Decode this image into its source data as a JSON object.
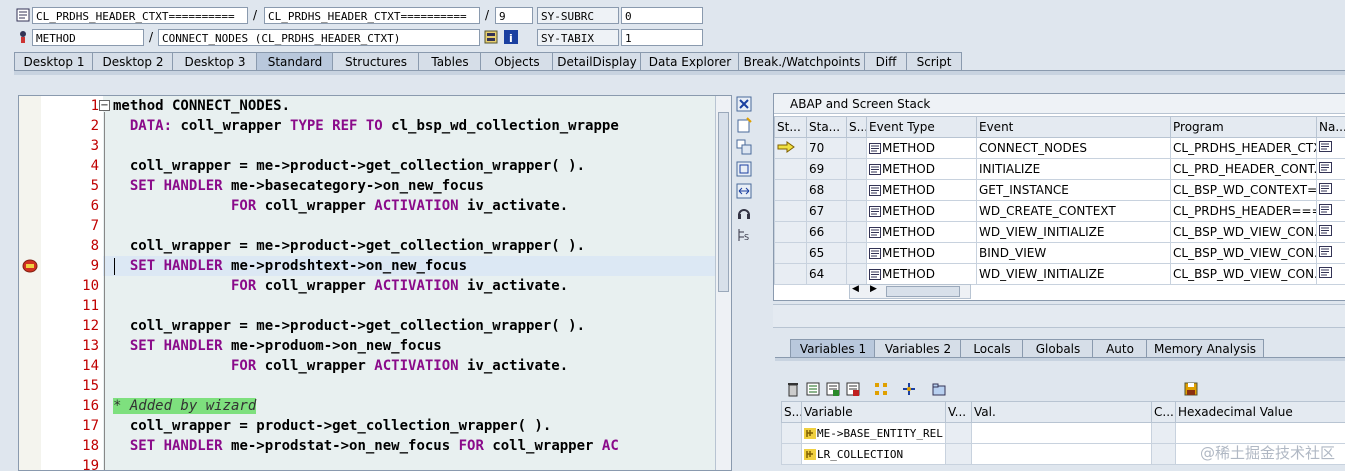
{
  "header": {
    "row1": {
      "program": "CL_PRDHS_HEADER_CTXT==========",
      "include": "CL_PRDHS_HEADER_CTXT==========",
      "line": "9",
      "sysfield": "SY-SUBRC",
      "sysvalue": "0"
    },
    "row2": {
      "event_type": "METHOD",
      "event": "CONNECT_NODES (CL_PRDHS_HEADER_CTXT)",
      "sysfield": "SY-TABIX",
      "sysvalue": "1"
    },
    "slash": "/"
  },
  "tabs": [
    "Desktop 1",
    "Desktop 2",
    "Desktop 3",
    "Standard",
    "Structures",
    "Tables",
    "Objects",
    "DetailDisplay",
    "Data Explorer",
    "Break./Watchpoints",
    "Diff",
    "Script"
  ],
  "active_tab": "Standard",
  "code": [
    {
      "n": "1",
      "parts": [
        {
          "t": "method CONNECT_NODES.",
          "c": ""
        }
      ]
    },
    {
      "n": "2",
      "parts": [
        {
          "t": "  DATA: ",
          "c": "kw"
        },
        {
          "t": "coll_wrapper ",
          "c": ""
        },
        {
          "t": "TYPE REF TO ",
          "c": "kw"
        },
        {
          "t": "cl_bsp_wd_collection_wrappe",
          "c": ""
        }
      ]
    },
    {
      "n": "3",
      "parts": [
        {
          "t": "",
          "c": ""
        }
      ]
    },
    {
      "n": "4",
      "parts": [
        {
          "t": "  coll_wrapper = me->product->get_collection_wrapper( ).",
          "c": ""
        }
      ]
    },
    {
      "n": "5",
      "parts": [
        {
          "t": "  SET HANDLER ",
          "c": "kw"
        },
        {
          "t": "me->basecategory->on_new_focus",
          "c": ""
        }
      ]
    },
    {
      "n": "6",
      "parts": [
        {
          "t": "              FOR ",
          "c": "kw"
        },
        {
          "t": "coll_wrapper ",
          "c": ""
        },
        {
          "t": "ACTIVATION ",
          "c": "kw"
        },
        {
          "t": "iv_activate.",
          "c": ""
        }
      ]
    },
    {
      "n": "7",
      "parts": [
        {
          "t": "",
          "c": ""
        }
      ]
    },
    {
      "n": "8",
      "parts": [
        {
          "t": "  coll_wrapper = me->product->get_collection_wrapper( ).",
          "c": ""
        }
      ]
    },
    {
      "n": "9",
      "parts": [
        {
          "t": "  SET HANDLER ",
          "c": "kw"
        },
        {
          "t": "me->prodshtext->on_new_focus",
          "c": ""
        }
      ]
    },
    {
      "n": "10",
      "parts": [
        {
          "t": "              FOR ",
          "c": "kw"
        },
        {
          "t": "coll_wrapper ",
          "c": ""
        },
        {
          "t": "ACTIVATION ",
          "c": "kw"
        },
        {
          "t": "iv_activate.",
          "c": ""
        }
      ]
    },
    {
      "n": "11",
      "parts": [
        {
          "t": "",
          "c": ""
        }
      ]
    },
    {
      "n": "12",
      "parts": [
        {
          "t": "  coll_wrapper = me->product->get_collection_wrapper( ).",
          "c": ""
        }
      ]
    },
    {
      "n": "13",
      "parts": [
        {
          "t": "  SET HANDLER ",
          "c": "kw"
        },
        {
          "t": "me->produom->on_new_focus",
          "c": ""
        }
      ]
    },
    {
      "n": "14",
      "parts": [
        {
          "t": "              FOR ",
          "c": "kw"
        },
        {
          "t": "coll_wrapper ",
          "c": ""
        },
        {
          "t": "ACTIVATION ",
          "c": "kw"
        },
        {
          "t": "iv_activate.",
          "c": ""
        }
      ]
    },
    {
      "n": "15",
      "parts": [
        {
          "t": "",
          "c": ""
        }
      ]
    },
    {
      "n": "16",
      "parts": [
        {
          "t": "* Added by wizard",
          "c": "cmt"
        }
      ]
    },
    {
      "n": "17",
      "parts": [
        {
          "t": "  coll_wrapper = product->get_collection_wrapper( ).",
          "c": ""
        }
      ]
    },
    {
      "n": "18",
      "parts": [
        {
          "t": "  SET HANDLER ",
          "c": "kw"
        },
        {
          "t": "me->prodstat->on_new_focus ",
          "c": ""
        },
        {
          "t": "FOR ",
          "c": "kw"
        },
        {
          "t": "coll_wrapper ",
          "c": ""
        },
        {
          "t": "AC",
          "c": "kw"
        }
      ]
    },
    {
      "n": "19",
      "parts": [
        {
          "t": "",
          "c": ""
        }
      ]
    }
  ],
  "current_line": "9",
  "stack": {
    "title": "ABAP and Screen Stack",
    "columns": [
      "St...",
      "Sta...",
      "S...",
      "Event Type",
      "Event",
      "Program",
      "Na..."
    ],
    "rows": [
      {
        "level": "70",
        "type": "METHOD",
        "event": "CONNECT_NODES",
        "program": "CL_PRDHS_HEADER_CTX...",
        "current": true
      },
      {
        "level": "69",
        "type": "METHOD",
        "event": "INITIALIZE",
        "program": "CL_PRD_HEADER_CONT...",
        "current": false
      },
      {
        "level": "68",
        "type": "METHOD",
        "event": "GET_INSTANCE",
        "program": "CL_BSP_WD_CONTEXT=...",
        "current": false
      },
      {
        "level": "67",
        "type": "METHOD",
        "event": "WD_CREATE_CONTEXT",
        "program": "CL_PRDHS_HEADER===...",
        "current": false
      },
      {
        "level": "66",
        "type": "METHOD",
        "event": "WD_VIEW_INITIALIZE",
        "program": "CL_BSP_WD_VIEW_CON...",
        "current": false
      },
      {
        "level": "65",
        "type": "METHOD",
        "event": "BIND_VIEW",
        "program": "CL_BSP_WD_VIEW_CON...",
        "current": false
      },
      {
        "level": "64",
        "type": "METHOD",
        "event": "WD_VIEW_INITIALIZE",
        "program": "CL_BSP_WD_VIEW_CON...",
        "current": false
      }
    ]
  },
  "var_tabs": [
    "Variables 1",
    "Variables 2",
    "Locals",
    "Globals",
    "Auto",
    "Memory Analysis"
  ],
  "active_var_tab": "Variables 1",
  "variables": {
    "columns": [
      "S...",
      "Variable",
      "V...",
      "Val.",
      "C...",
      "Hexadecimal Value"
    ],
    "rows": [
      {
        "name": "ME->BASE_ENTITY_REL...",
        "value": "",
        "hex": ""
      },
      {
        "name": "LR_COLLECTION",
        "value": "",
        "hex": ""
      }
    ]
  },
  "watermark": "@稀土掘金技术社区",
  "colors": {
    "keyword": "#8a0a8a",
    "line_number": "#c00000",
    "comment_bg": "#7ee07e"
  }
}
